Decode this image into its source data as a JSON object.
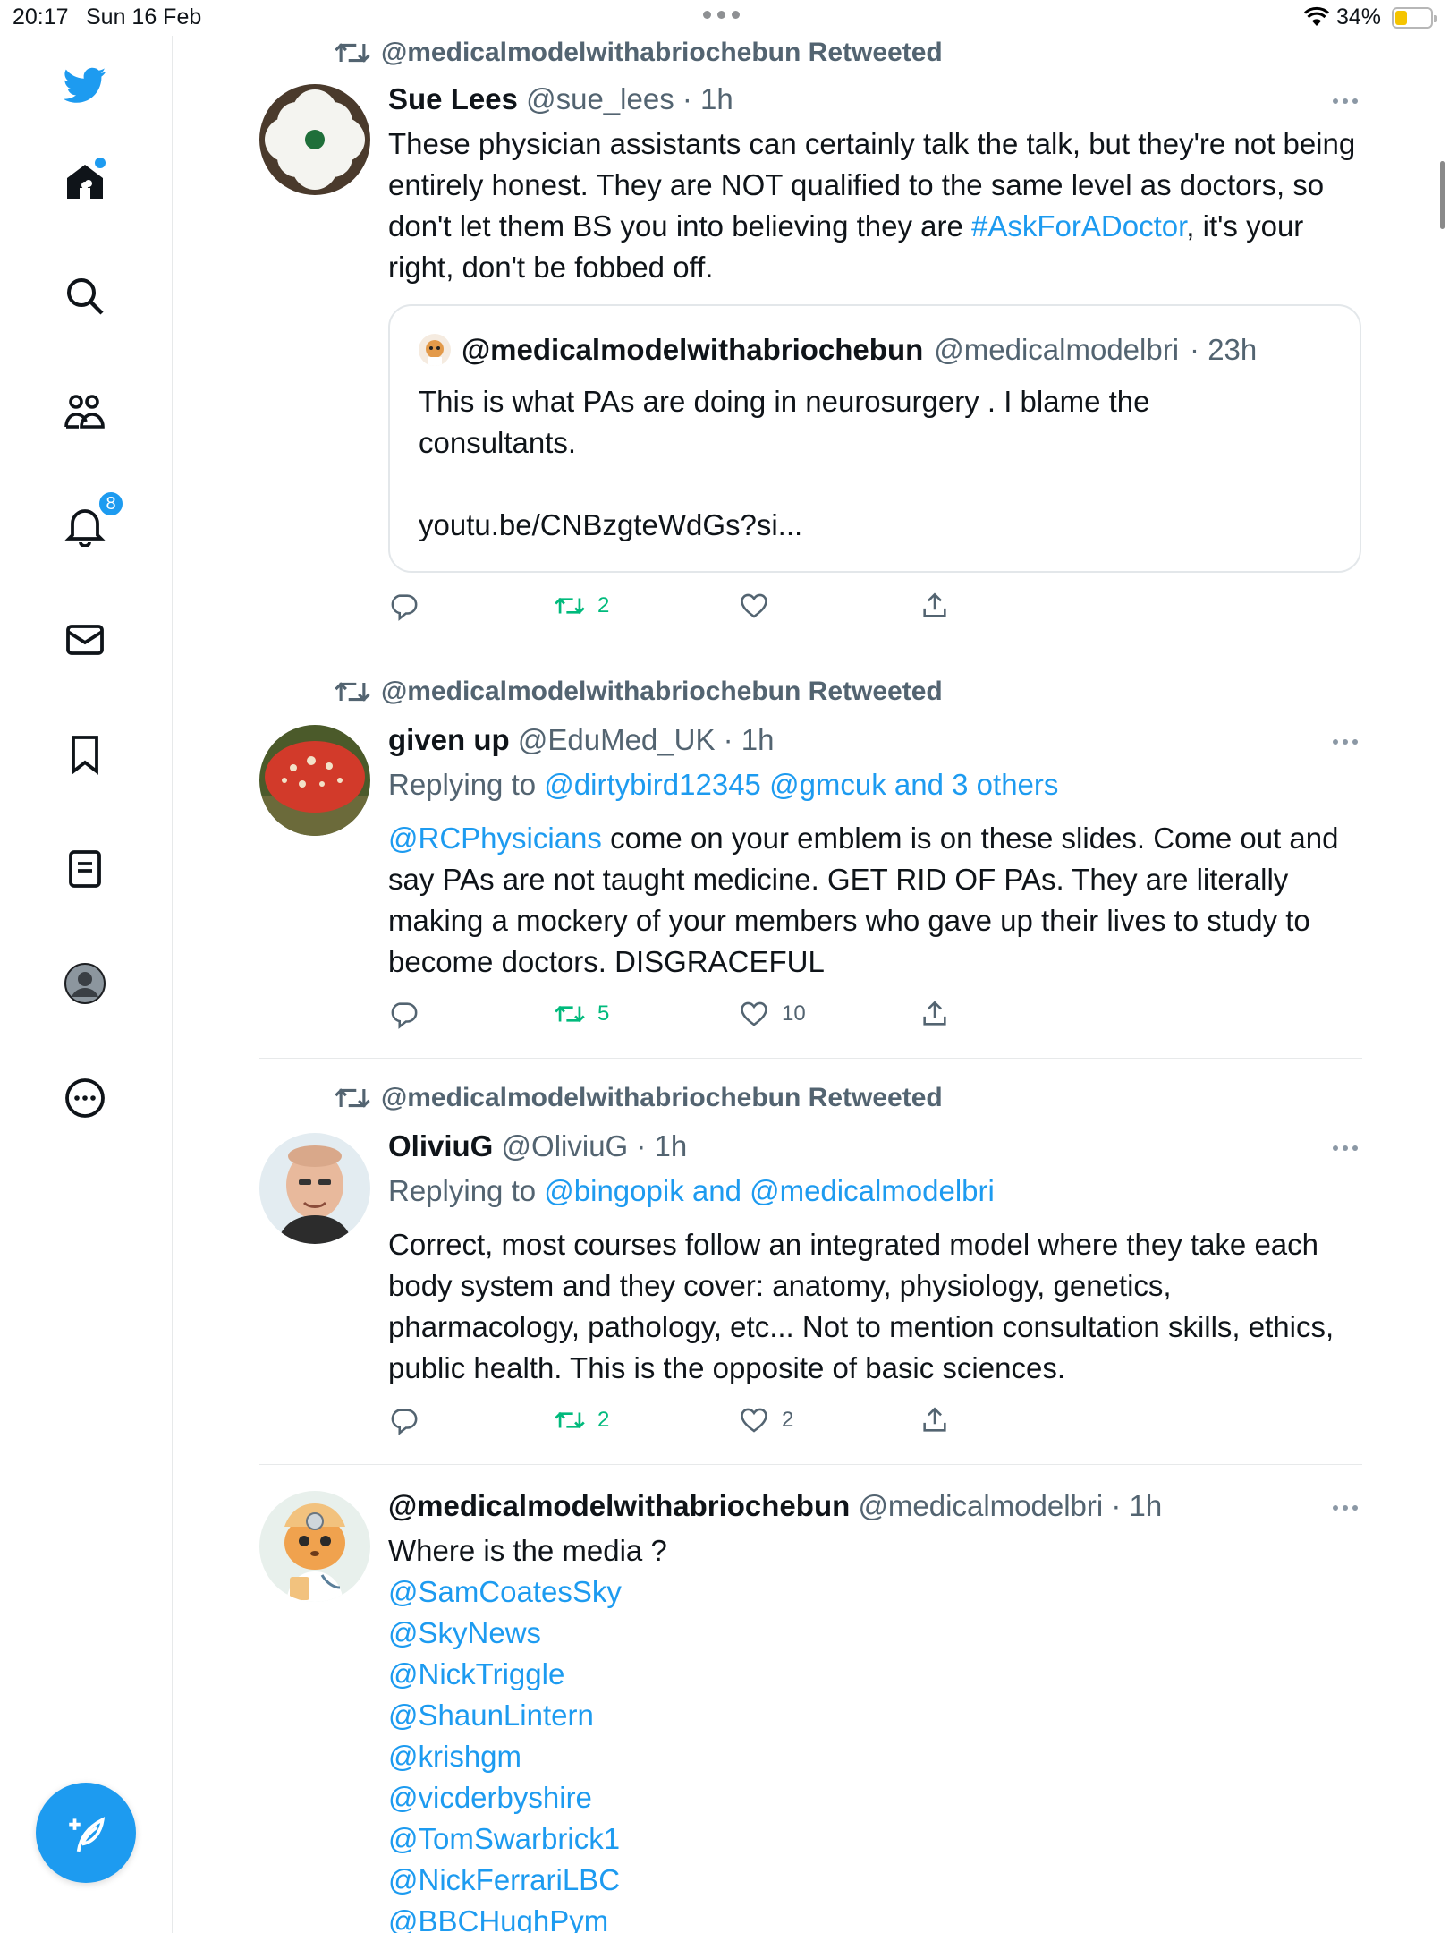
{
  "status_bar": {
    "time": "20:17",
    "date": "Sun 16 Feb",
    "battery_percent": "34%",
    "battery_level": 0.34,
    "icons": [
      "wifi-icon",
      "battery-icon"
    ]
  },
  "sidebar": {
    "items": [
      {
        "name": "twitter-logo",
        "icon": "bird"
      },
      {
        "name": "home",
        "icon": "home",
        "has_new_dot": true
      },
      {
        "name": "explore",
        "icon": "search"
      },
      {
        "name": "communities",
        "icon": "people"
      },
      {
        "name": "notifications",
        "icon": "bell",
        "badge": "8"
      },
      {
        "name": "messages",
        "icon": "envelope"
      },
      {
        "name": "bookmarks",
        "icon": "bookmark"
      },
      {
        "name": "lists",
        "icon": "list"
      },
      {
        "name": "profile",
        "icon": "avatar"
      },
      {
        "name": "more",
        "icon": "more-circle"
      }
    ],
    "compose_icon": "compose-icon",
    "accent": "#1d9bf0"
  },
  "tweets": [
    {
      "retweeted_by": "@medicalmodelwithabriochebun Retweeted",
      "name": "Sue Lees",
      "handle": "@sue_lees",
      "time": "· 1h",
      "text_parts": {
        "p1": "These physician assistants can certainly talk the talk, but they're not being entirely honest. They are NOT qualified to the same level as doctors, so don't let them BS you into believing they are ",
        "hashtag": "#AskForADoctor",
        "p2": ",  it's your right, don't be fobbed off."
      },
      "quote": {
        "name": "@medicalmodelwithabriochebun",
        "handle": "@medicalmodelbri",
        "time": "· 23h",
        "line1": "This is what PAs are doing in neurosurgery . I blame the consultants.",
        "line2": "youtu.be/CNBzgteWdGs?si..."
      },
      "retweets": "2",
      "likes": ""
    },
    {
      "retweeted_by": "@medicalmodelwithabriochebun Retweeted",
      "name": "given up",
      "handle": "@EduMed_UK",
      "time": "· 1h",
      "replying_label": "Replying to ",
      "replying_to": "@dirtybird12345 @gmcuk and 3 others",
      "mention": "@RCPhysicians",
      "text": " come on your emblem is on these slides. Come out and say PAs are not taught medicine. GET RID OF PAs. They are literally making a mockery of your members who gave up their lives to study to become doctors. DISGRACEFUL",
      "retweets": "5",
      "likes": "10"
    },
    {
      "retweeted_by": "@medicalmodelwithabriochebun Retweeted",
      "name": "OliviuG",
      "handle": "@OliviuG",
      "time": "· 1h",
      "replying_label": "Replying to ",
      "replying_to": "@bingopik and @medicalmodelbri",
      "text": "Correct, most courses follow an integrated model where they take each body system and they cover: anatomy, physiology, genetics, pharmacology, pathology, etc... Not to mention consultation skills, ethics, public health. This is the opposite of basic sciences.",
      "retweets": "2",
      "likes": "2"
    },
    {
      "name": "@medicalmodelwithabriochebun",
      "handle": "@medicalmodelbri",
      "time": "· 1h",
      "text": "Where is the media  ?",
      "mentions": [
        "@SamCoatesSky",
        "@SkyNews",
        "@NickTriggle",
        "@ShaunLintern",
        "@krishgm",
        "@vicderbyshire",
        "@TomSwarbrick1",
        "@NickFerrariLBC",
        "@BBCHughPym"
      ]
    }
  ]
}
